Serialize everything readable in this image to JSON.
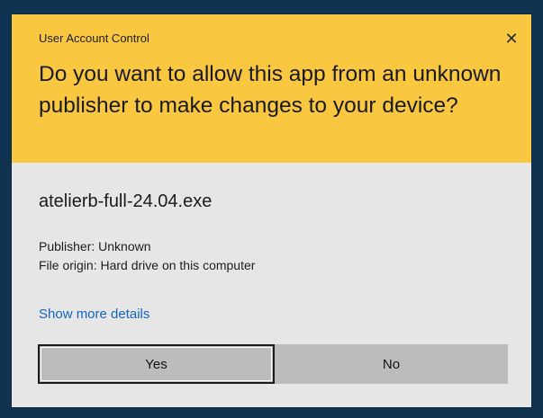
{
  "dialog": {
    "title": "User Account Control",
    "close_glyph": "✕",
    "question": "Do you want to allow this app from an unknown publisher to make changes to your device?",
    "app_name": "atelierb-full-24.04.exe",
    "publisher": "Publisher: Unknown",
    "file_origin": "File origin: Hard drive on this computer",
    "details_link": "Show more details",
    "yes_label": "Yes",
    "no_label": "No",
    "colors": {
      "header": "#f9c740",
      "body": "#e6e6e6",
      "button": "#bcbcbc",
      "link": "#1565c0",
      "frame": "#0f3350"
    },
    "icons": {
      "close": "close-icon"
    }
  }
}
